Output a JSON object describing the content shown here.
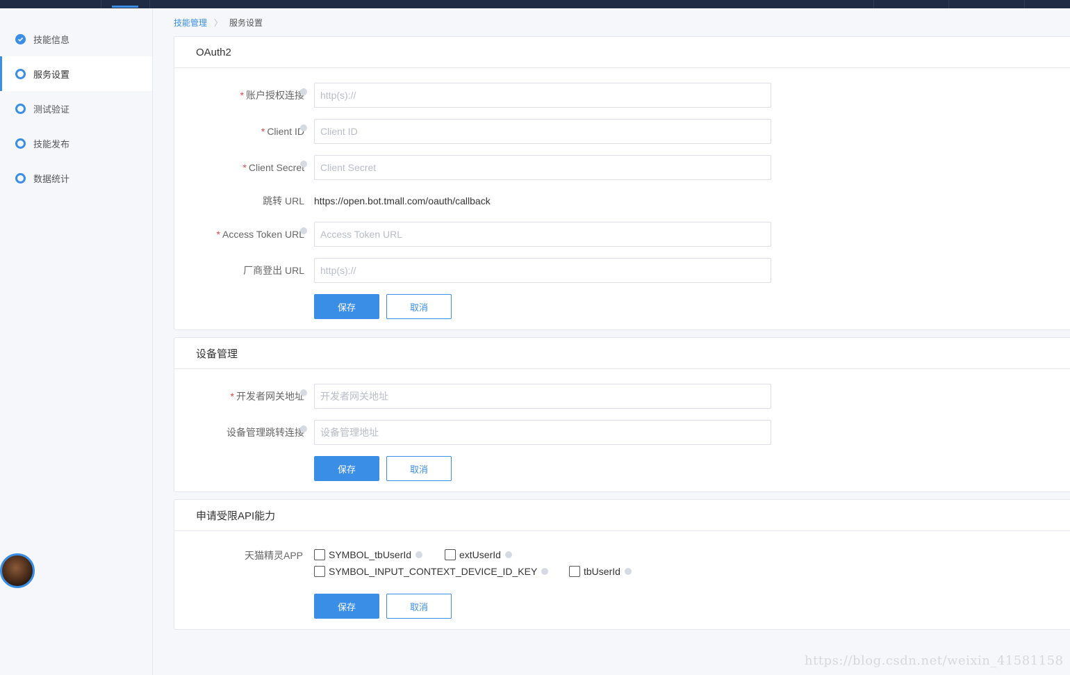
{
  "breadcrumb": {
    "parent": "技能管理",
    "current": "服务设置"
  },
  "sidebar": {
    "items": [
      {
        "label": "技能信息",
        "state": "done"
      },
      {
        "label": "服务设置",
        "state": "active"
      },
      {
        "label": "测试验证",
        "state": "todo"
      },
      {
        "label": "技能发布",
        "state": "todo"
      },
      {
        "label": "数据统计",
        "state": "todo"
      }
    ]
  },
  "oauth": {
    "title": "OAuth2",
    "auth_url_label": "账户授权连接",
    "auth_url_placeholder": "http(s)://",
    "client_id_label": "Client ID",
    "client_id_placeholder": "Client ID",
    "client_secret_label": "Client Secret",
    "client_secret_placeholder": "Client Secret",
    "redirect_label": "跳转 URL",
    "redirect_value": "https://open.bot.tmall.com/oauth/callback",
    "token_url_label": "Access Token URL",
    "token_url_placeholder": "Access Token URL",
    "logout_url_label": "厂商登出 URL",
    "logout_url_placeholder": "http(s)://",
    "save_label": "保存",
    "cancel_label": "取消"
  },
  "device": {
    "title": "设备管理",
    "gateway_label": "开发者网关地址",
    "gateway_placeholder": "开发者网关地址",
    "jump_label": "设备管理跳转连接",
    "jump_placeholder": "设备管理地址",
    "save_label": "保存",
    "cancel_label": "取消"
  },
  "api": {
    "title": "申请受限API能力",
    "app_label": "天猫精灵APP",
    "options": [
      "SYMBOL_tbUserId",
      "extUserId",
      "SYMBOL_INPUT_CONTEXT_DEVICE_ID_KEY",
      "tbUserId"
    ],
    "save_label": "保存",
    "cancel_label": "取消"
  },
  "watermark": "https://blog.csdn.net/weixin_41581158",
  "colors": {
    "accent": "#3a8ee6",
    "required": "#e8423c",
    "topbar": "#1f2a44"
  }
}
